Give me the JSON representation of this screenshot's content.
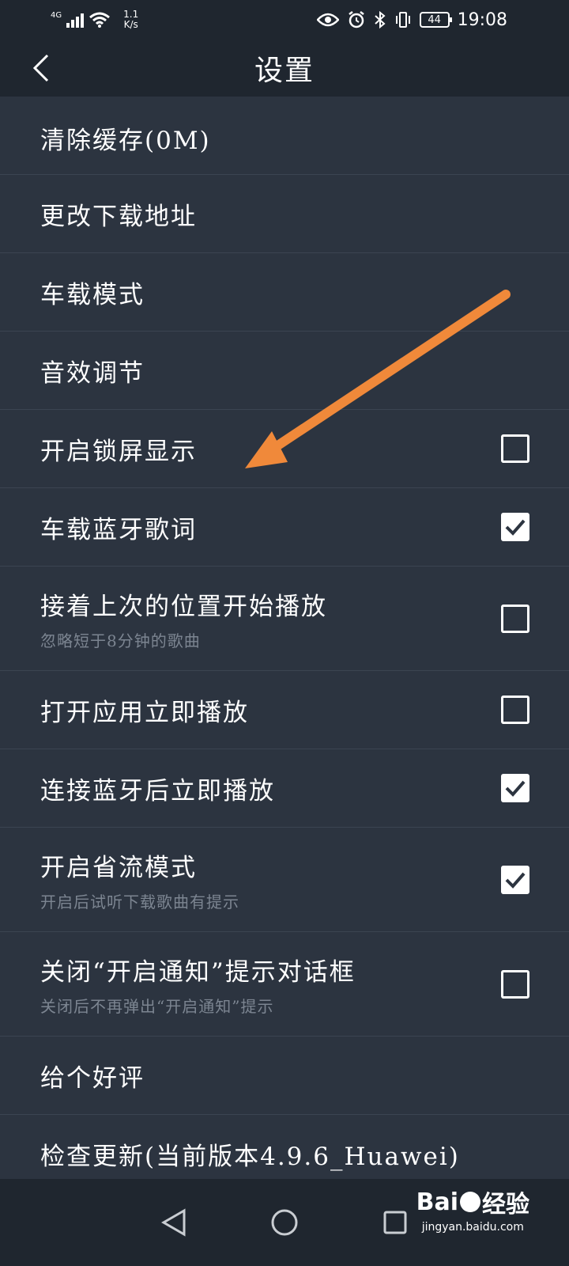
{
  "status_bar": {
    "network_type": "4G",
    "speed_value": "1.1",
    "speed_unit": "K/s",
    "battery": "44",
    "time": "19:08",
    "icons": [
      "signal-icon",
      "wifi-icon",
      "eye-icon",
      "alarm-icon",
      "bluetooth-icon",
      "vibrate-icon",
      "battery-icon"
    ]
  },
  "header": {
    "title": "设置",
    "back_icon": "back-arrow-icon"
  },
  "settings": [
    {
      "label": "清除缓存(0M)",
      "sub": "",
      "has_checkbox": false,
      "checked": false
    },
    {
      "label": "更改下载地址",
      "sub": "",
      "has_checkbox": false,
      "checked": false
    },
    {
      "label": "车载模式",
      "sub": "",
      "has_checkbox": false,
      "checked": false
    },
    {
      "label": "音效调节",
      "sub": "",
      "has_checkbox": false,
      "checked": false
    },
    {
      "label": "开启锁屏显示",
      "sub": "",
      "has_checkbox": true,
      "checked": false
    },
    {
      "label": "车载蓝牙歌词",
      "sub": "",
      "has_checkbox": true,
      "checked": true
    },
    {
      "label": "接着上次的位置开始播放",
      "sub": "忽略短于8分钟的歌曲",
      "has_checkbox": true,
      "checked": false
    },
    {
      "label": "打开应用立即播放",
      "sub": "",
      "has_checkbox": true,
      "checked": false
    },
    {
      "label": "连接蓝牙后立即播放",
      "sub": "",
      "has_checkbox": true,
      "checked": true
    },
    {
      "label": "开启省流模式",
      "sub": "开启后试听下载歌曲有提示",
      "has_checkbox": true,
      "checked": true
    },
    {
      "label": "关闭“开启通知”提示对话框",
      "sub": "关闭后不再弹出“开启通知”提示",
      "has_checkbox": true,
      "checked": false
    },
    {
      "label": "给个好评",
      "sub": "",
      "has_checkbox": false,
      "checked": false
    },
    {
      "label": "检查更新(当前版本4.9.6_Huawei)",
      "sub": "",
      "has_checkbox": false,
      "checked": false
    }
  ],
  "annotation": {
    "arrow_color": "#f0893a"
  },
  "nav_bar": {
    "icons": [
      "nav-back-icon",
      "nav-home-icon",
      "nav-recents-icon"
    ]
  },
  "watermark": {
    "brand_left": "Bai",
    "brand_right": "经验",
    "url": "jingyan.baidu.com"
  },
  "colors": {
    "background": "#2c3440",
    "bar": "#1f262f",
    "divider": "#3b4451",
    "subtext": "#7c8591"
  }
}
